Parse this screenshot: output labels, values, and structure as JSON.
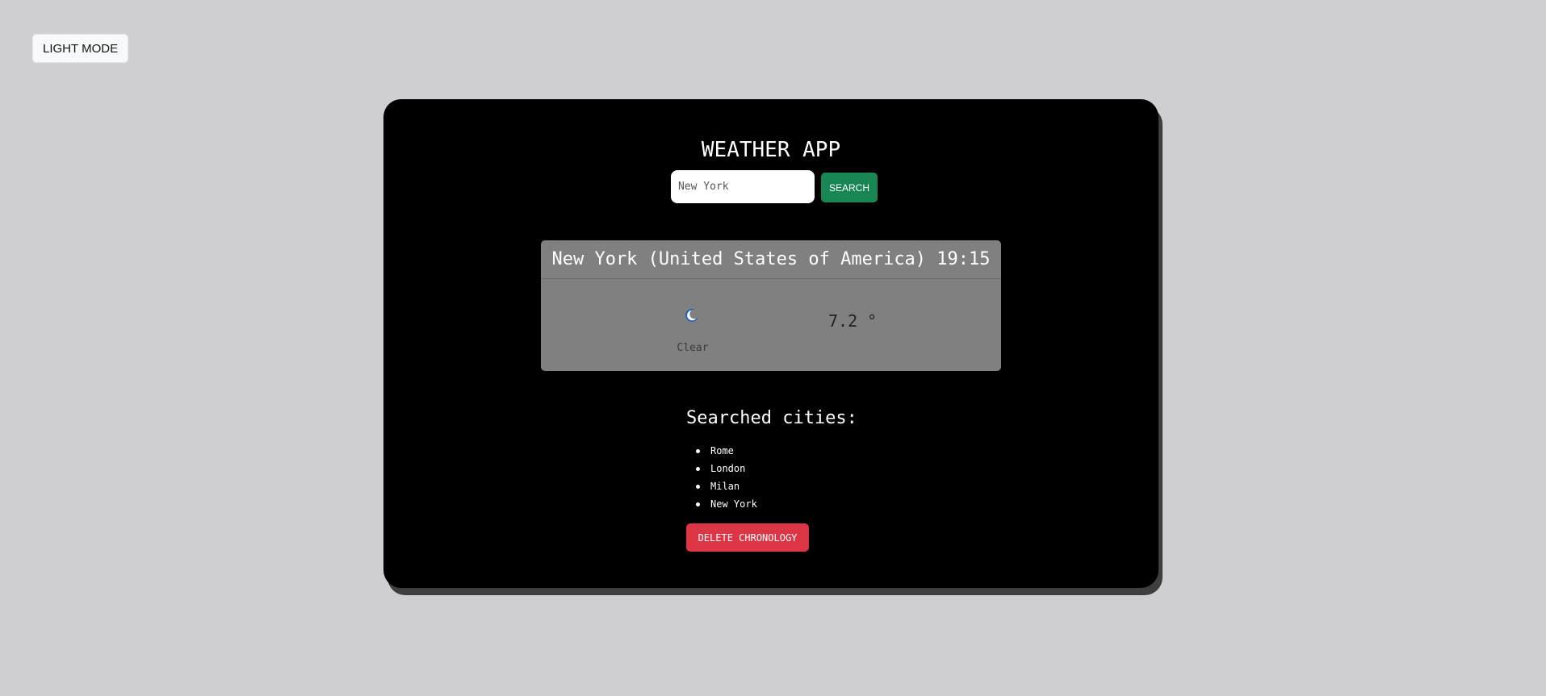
{
  "mode_toggle": {
    "label": "LIGHT MODE"
  },
  "app": {
    "title": "WEATHER APP"
  },
  "search": {
    "value": "New York",
    "button_label": "SEARCH"
  },
  "weather": {
    "header": "New York (United States of America) 19:15",
    "icon": "crescent-moon-icon",
    "condition": "Clear",
    "temperature": "7.2 °"
  },
  "history": {
    "title": "Searched cities:",
    "cities": [
      "Rome",
      "London",
      "Milan",
      "New York"
    ],
    "delete_label": "DELETE CHRONOLOGY"
  },
  "colors": {
    "page_background": "#cfcfd1",
    "card_background": "#000000",
    "search_button": "#198754",
    "delete_button": "#dc3545",
    "weather_box": "#808080"
  }
}
